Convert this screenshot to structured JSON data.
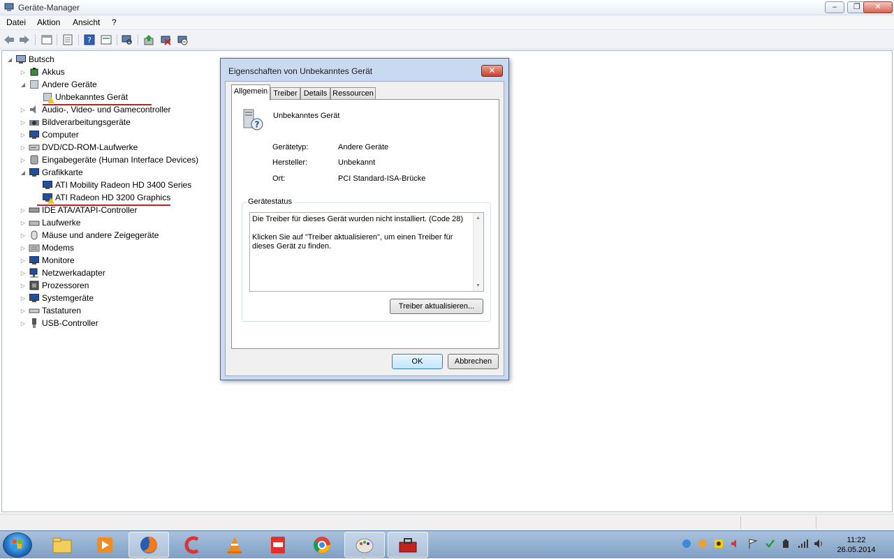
{
  "window": {
    "title": "Geräte-Manager"
  },
  "menu": [
    "Datei",
    "Aktion",
    "Ansicht",
    "?"
  ],
  "toolbar_icons": [
    "back-icon",
    "forward-icon",
    "view-icon",
    "properties-icon",
    "list-icon",
    "help-icon",
    "monitor-icon",
    "scan-icon",
    "update-driver-icon",
    "uninstall-icon",
    "disable-icon"
  ],
  "tree": {
    "root": "Butsch",
    "items": [
      "Akkus",
      "Andere Geräte",
      "Unbekanntes Gerät",
      "Audio-, Video- und Gamecontroller",
      "Bildverarbeitungsgeräte",
      "Computer",
      "DVD/CD-ROM-Laufwerke",
      "Eingabegeräte (Human Interface Devices)",
      "Grafikkarte",
      "ATI Mobility Radeon HD 3400 Series",
      "ATI Radeon HD 3200 Graphics",
      "IDE ATA/ATAPI-Controller",
      "Laufwerke",
      "Mäuse und andere Zeigegeräte",
      "Modems",
      "Monitore",
      "Netzwerkadapter",
      "Prozessoren",
      "Systemgeräte",
      "Tastaturen",
      "USB-Controller"
    ]
  },
  "dialog": {
    "title": "Eigenschaften von Unbekanntes Gerät",
    "close": "✕",
    "tabs": [
      "Allgemein",
      "Treiber",
      "Details",
      "Ressourcen"
    ],
    "device_name": "Unbekanntes Gerät",
    "props": [
      {
        "label": "Gerätetyp:",
        "value": "Andere Geräte"
      },
      {
        "label": "Hersteller:",
        "value": "Unbekannt"
      },
      {
        "label": "Ort:",
        "value": "PCI Standard-ISA-Brücke"
      }
    ],
    "status_group": "Gerätestatus",
    "status_line1": "Die Treiber für dieses Gerät wurden nicht installiert. (Code 28)",
    "status_line2": "Klicken Sie auf \"Treiber aktualisieren\", um einen Treiber für dieses Gerät zu finden.",
    "update_button": "Treiber aktualisieren...",
    "ok": "OK",
    "cancel": "Abbrechen"
  },
  "taskbar": {
    "apps": [
      "explorer",
      "media-player",
      "firefox",
      "ccleaner",
      "vlc",
      "pdf",
      "chrome",
      "paint",
      "toolbox"
    ],
    "time": "11:22",
    "date": "26.05.2014"
  }
}
